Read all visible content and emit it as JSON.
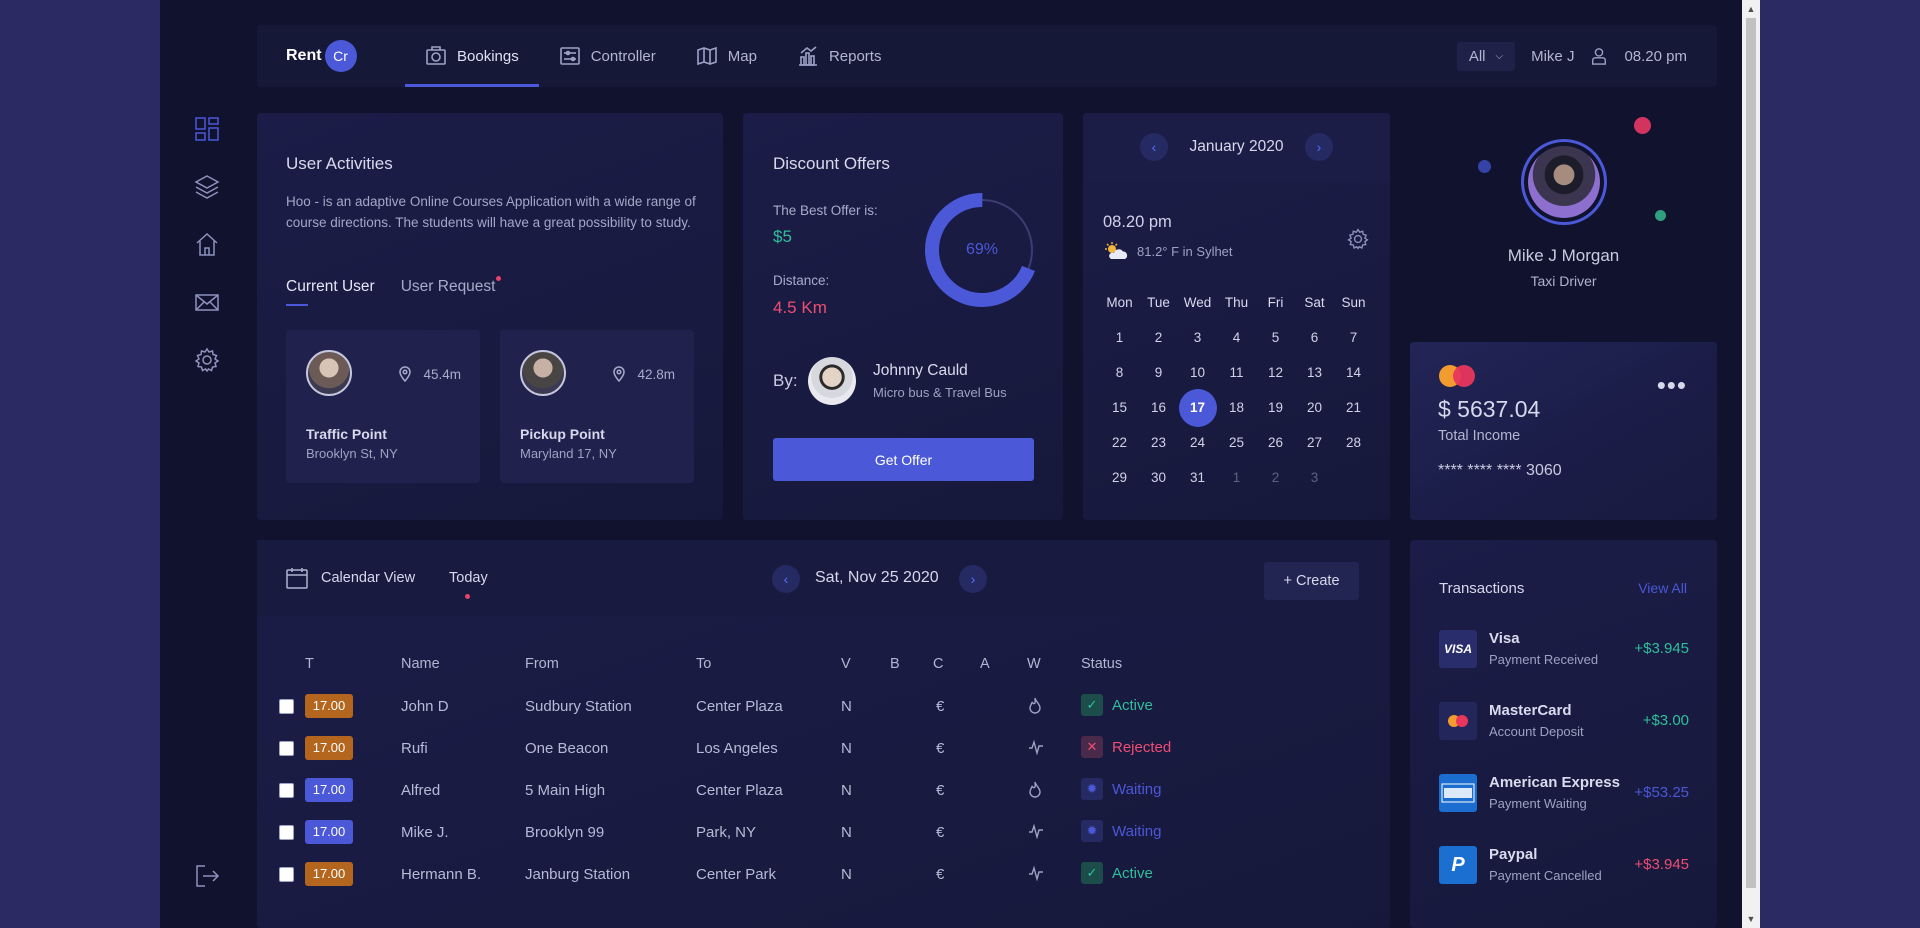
{
  "brand": {
    "name": "Rent",
    "badge": "Cr"
  },
  "nav": {
    "tabs": [
      {
        "label": "Bookings",
        "icon": "camera-icon",
        "active": true
      },
      {
        "label": "Controller",
        "icon": "sliders-icon"
      },
      {
        "label": "Map",
        "icon": "map-icon"
      },
      {
        "label": "Reports",
        "icon": "chart-icon"
      }
    ],
    "filter": "All",
    "user": "Mike J",
    "time": "08.20 pm"
  },
  "user_activities": {
    "title": "User Activities",
    "description": "Hoo - is an adaptive Online Courses Application with a wide range of course directions. The students will have a great possibility to study.",
    "tab_current": "Current User",
    "tab_request": "User Request",
    "cards": [
      {
        "distance": "45.4m",
        "name": "Traffic Point",
        "address": "Brooklyn St, NY"
      },
      {
        "distance": "42.8m",
        "name": "Pickup Point",
        "address": "Maryland 17, NY"
      }
    ]
  },
  "discount": {
    "title": "Discount Offers",
    "best_label": "The Best Offer is:",
    "best_value": "$5",
    "distance_label": "Distance:",
    "distance_value": "4.5 Km",
    "percent": 69,
    "percent_label": "69%",
    "by_label": "By:",
    "person_name": "Johnny Cauld",
    "person_sub": "Micro bus & Travel Bus",
    "button": "Get Offer"
  },
  "calendar": {
    "month": "January 2020",
    "time": "08.20 pm",
    "weather": "81.2° F in Sylhet",
    "days_of_week": [
      "Mon",
      "Tue",
      "Wed",
      "Thu",
      "Fri",
      "Sat",
      "Sun"
    ],
    "weeks": [
      [
        "1",
        "2",
        "3",
        "4",
        "5",
        "6",
        "7"
      ],
      [
        "8",
        "9",
        "10",
        "11",
        "12",
        "13",
        "14"
      ],
      [
        "15",
        "16",
        "17",
        "18",
        "19",
        "20",
        "21"
      ],
      [
        "22",
        "23",
        "24",
        "25",
        "26",
        "27",
        "28"
      ],
      [
        "29",
        "30",
        "31",
        "1",
        "2",
        "3",
        ""
      ]
    ],
    "selected": "17"
  },
  "profile": {
    "name": "Mike J Morgan",
    "role": "Taxi Driver"
  },
  "income": {
    "amount": "$ 5637.04",
    "label": "Total Income",
    "card": "**** **** **** 3060",
    "more": "•••"
  },
  "bookings": {
    "calendar_view": "Calendar View",
    "today": "Today",
    "date": "Sat, Nov 25 2020",
    "create": "+ Create",
    "columns": [
      "T",
      "Name",
      "From",
      "To",
      "V",
      "B",
      "C",
      "A",
      "W",
      "Status"
    ],
    "rows": [
      {
        "tag": "17.00",
        "tag_color": "#b4661f",
        "name": "John D",
        "from": "Sudbury Station",
        "to": "Center Plaza",
        "v": "N",
        "c": "€",
        "w": "flame",
        "status": "Active"
      },
      {
        "tag": "17.00",
        "tag_color": "#b4661f",
        "name": "Rufi",
        "from": "One Beacon",
        "to": "Los Angeles",
        "v": "N",
        "c": "€",
        "w": "pulse",
        "status": "Rejected"
      },
      {
        "tag": "17.00",
        "tag_color": "#4b58d8",
        "name": "Alfred",
        "from": "5 Main High",
        "to": "Center Plaza",
        "v": "N",
        "c": "€",
        "w": "flame",
        "status": "Waiting"
      },
      {
        "tag": "17.00",
        "tag_color": "#4b58d8",
        "name": "Mike J.",
        "from": "Brooklyn 99",
        "to": "Park, NY",
        "v": "N",
        "c": "€",
        "w": "pulse",
        "status": "Waiting"
      },
      {
        "tag": "17.00",
        "tag_color": "#b4661f",
        "name": "Hermann B.",
        "from": "Janburg Station",
        "to": "Center Park",
        "v": "N",
        "c": "€",
        "w": "pulse",
        "status": "Active"
      }
    ]
  },
  "transactions": {
    "title": "Transactions",
    "view_all": "View All",
    "items": [
      {
        "name": "Visa",
        "sub": "Payment Received",
        "amount": "+$3.945",
        "color": "#2fbf9a",
        "icon_text": "VISA",
        "icon_bg": "#2a2d6b"
      },
      {
        "name": "MasterCard",
        "sub": "Account Deposit",
        "amount": "+$3.00",
        "color": "#2fbf9a",
        "icon_text": "",
        "icon_bg": "#23265a"
      },
      {
        "name": "American Express",
        "sub": "Payment Waiting",
        "amount": "+$53.25",
        "color": "#4b58d8",
        "icon_text": "AMEX",
        "icon_bg": "#1b6ed0"
      },
      {
        "name": "Paypal",
        "sub": "Payment Cancelled",
        "amount": "+$3.945",
        "color": "#ef4d74",
        "icon_text": "P",
        "icon_bg": "#1a6fd0"
      }
    ]
  },
  "colors": {
    "accent": "#4b58d8",
    "success": "#2fbf9a",
    "danger": "#ef4d74",
    "background": "#11122e"
  }
}
